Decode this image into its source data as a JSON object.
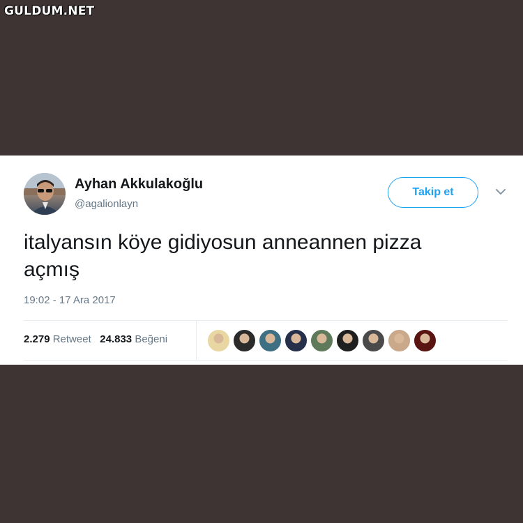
{
  "watermark": "GULDUM.NET",
  "tweet": {
    "author_name": "Ayhan Akkulakoğlu",
    "author_handle": "@agalionlayn",
    "follow_label": "Takip et",
    "text_line1": "italyansın köye gidiyosun anneannen pizza",
    "text_line2": "açmış",
    "timestamp": "19:02 - 17 Ara 2017",
    "retweet_count": "2.279",
    "retweet_label": "Retweet",
    "like_count": "24.833",
    "like_label": "Beğeni"
  },
  "icons": {
    "menu": "chevron-down-icon",
    "avatar": "user-avatar"
  },
  "colors": {
    "background": "#3e3434",
    "accent": "#1da1f2",
    "secondary_text": "#657786",
    "primary_text": "#14171a"
  },
  "likers": [
    {
      "color": "#e9d7a3"
    },
    {
      "color": "#2b2b2b"
    },
    {
      "color": "#3f6f82"
    },
    {
      "color": "#26304a"
    },
    {
      "color": "#5e7a5a"
    },
    {
      "color": "#1f1f1f"
    },
    {
      "color": "#4a4a4a"
    },
    {
      "color": "#c9a98a"
    },
    {
      "color": "#5a1412"
    }
  ]
}
